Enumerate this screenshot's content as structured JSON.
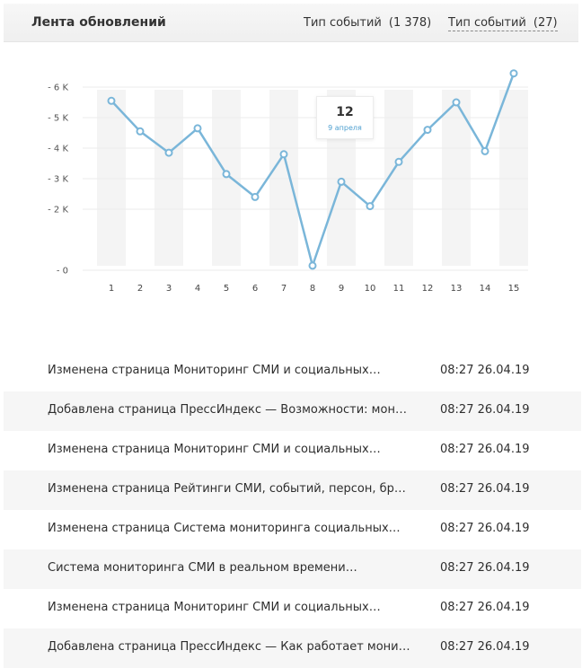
{
  "header": {
    "title": "Лента обновлений",
    "filters": [
      {
        "label": "Тип событий",
        "count": "(1 378)"
      },
      {
        "label": "Тип событий",
        "count": "(27)"
      }
    ]
  },
  "chart_data": {
    "type": "line",
    "x": [
      1,
      2,
      3,
      4,
      5,
      6,
      7,
      8,
      9,
      10,
      11,
      12,
      13,
      14,
      15
    ],
    "values": [
      5550,
      4550,
      3850,
      4650,
      3150,
      2400,
      3800,
      150,
      2900,
      2100,
      3550,
      4600,
      5500,
      3900,
      6450
    ],
    "y_ticks": [
      "- 0",
      "- 2 K",
      "- 3 K",
      "- 4 K",
      "- 5 K",
      "- 6 K"
    ],
    "y_tick_values": [
      0,
      2000,
      3000,
      4000,
      5000,
      6000
    ],
    "ylim": [
      0,
      6500
    ],
    "line_color": "#7ab6d9",
    "striped_columns": [
      1,
      3,
      5,
      7,
      9,
      11,
      13,
      15
    ]
  },
  "tooltip": {
    "value": "12",
    "date": "9 апреля"
  },
  "feed": [
    {
      "text": "Изменена страница Мониторинг СМИ и социальных…",
      "time": "08:27 26.04.19"
    },
    {
      "text": "Добавлена страница ПрессИндекс — Возможности: мон…",
      "time": "08:27 26.04.19"
    },
    {
      "text": "Изменена страница Мониторинг СМИ и социальных…",
      "time": "08:27 26.04.19"
    },
    {
      "text": "Изменена страница Рейтинги СМИ, событий, персон, бр…",
      "time": "08:27 26.04.19"
    },
    {
      "text": "Изменена страница Система мониторинга социальных…",
      "time": "08:27 26.04.19"
    },
    {
      "text": "Система мониторинга СМИ в реальном времени…",
      "time": "08:27 26.04.19"
    },
    {
      "text": "Изменена страница Мониторинг СМИ и социальных…",
      "time": "08:27 26.04.19"
    },
    {
      "text": "Добавлена страница ПрессИндекс — Как работает мони…",
      "time": "08:27 26.04.19"
    }
  ]
}
